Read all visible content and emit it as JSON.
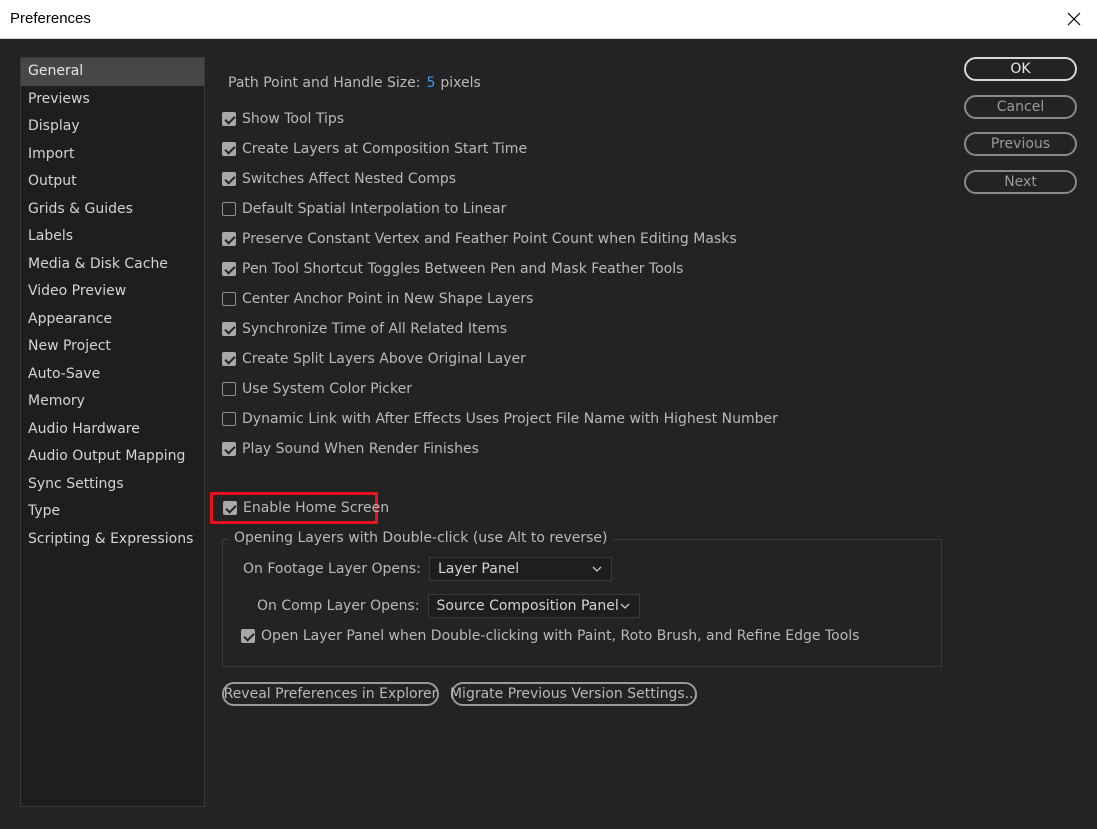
{
  "window": {
    "title": "Preferences"
  },
  "sidebar": {
    "items": [
      {
        "label": "General",
        "selected": true
      },
      {
        "label": "Previews"
      },
      {
        "label": "Display"
      },
      {
        "label": "Import"
      },
      {
        "label": "Output"
      },
      {
        "label": "Grids & Guides"
      },
      {
        "label": "Labels"
      },
      {
        "label": "Media & Disk Cache"
      },
      {
        "label": "Video Preview"
      },
      {
        "label": "Appearance"
      },
      {
        "label": "New Project"
      },
      {
        "label": "Auto-Save"
      },
      {
        "label": "Memory"
      },
      {
        "label": "Audio Hardware"
      },
      {
        "label": "Audio Output Mapping"
      },
      {
        "label": "Sync Settings"
      },
      {
        "label": "Type"
      },
      {
        "label": "Scripting & Expressions"
      }
    ]
  },
  "general": {
    "path_point_label": "Path Point and Handle Size:",
    "path_point_value": "5",
    "path_point_unit": "pixels",
    "checkboxes": [
      {
        "label": "Show Tool Tips",
        "checked": true
      },
      {
        "label": "Create Layers at Composition Start Time",
        "checked": true
      },
      {
        "label": "Switches Affect Nested Comps",
        "checked": true
      },
      {
        "label": "Default Spatial Interpolation to Linear",
        "checked": false
      },
      {
        "label": "Preserve Constant Vertex and Feather Point Count when Editing Masks",
        "checked": true
      },
      {
        "label": "Pen Tool Shortcut Toggles Between Pen and Mask Feather Tools",
        "checked": true
      },
      {
        "label": "Center Anchor Point in New Shape Layers",
        "checked": false
      },
      {
        "label": "Synchronize Time of All Related Items",
        "checked": true
      },
      {
        "label": "Create Split Layers Above Original Layer",
        "checked": true
      },
      {
        "label": "Use System Color Picker",
        "checked": false
      },
      {
        "label": "Dynamic Link with After Effects Uses Project File Name with Highest Number",
        "checked": false
      },
      {
        "label": "Play Sound When Render Finishes",
        "checked": true
      }
    ],
    "home_screen": {
      "label": "Enable Home Screen",
      "checked": true
    },
    "double_click_group": {
      "title": "Opening Layers with Double-click (use Alt to reverse)",
      "footage_label": "On Footage Layer Opens:",
      "footage_value": "Layer Panel",
      "comp_label": "On Comp Layer Opens:",
      "comp_value": "Source Composition Panel",
      "open_layer_panel": {
        "label": "Open Layer Panel when Double-clicking with Paint, Roto Brush, and Refine Edge Tools",
        "checked": true
      }
    },
    "reveal_button": "Reveal Preferences in Explorer",
    "migrate_button": "Migrate Previous Version Settings..."
  },
  "buttons": {
    "ok": "OK",
    "cancel": "Cancel",
    "previous": "Previous",
    "next": "Next"
  },
  "colors": {
    "highlight_box": "#e8111f",
    "value_blue": "#3c9bf4"
  }
}
